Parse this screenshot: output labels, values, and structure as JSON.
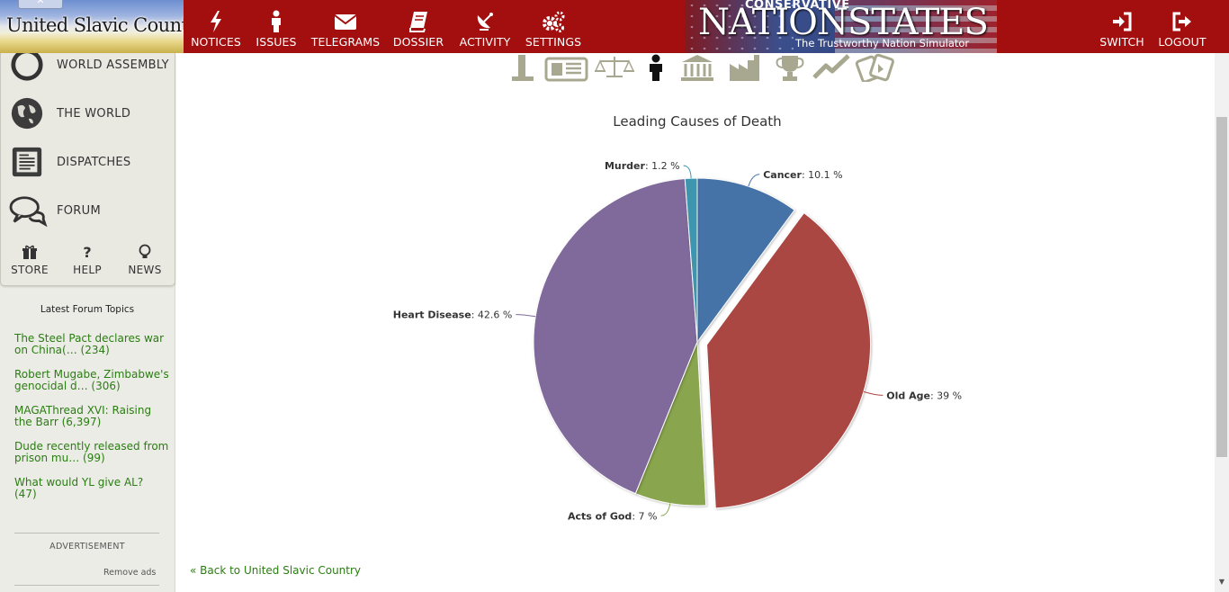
{
  "header": {
    "nation_name": "United Slavic Country",
    "nav": [
      {
        "label": "NOTICES",
        "icon": "lightning-icon"
      },
      {
        "label": "ISSUES",
        "icon": "person-icon"
      },
      {
        "label": "TELEGRAMS",
        "icon": "envelope-icon"
      },
      {
        "label": "DOSSIER",
        "icon": "book-icon"
      },
      {
        "label": "ACTIVITY",
        "icon": "satellite-dish-icon"
      },
      {
        "label": "SETTINGS",
        "icon": "gears-icon"
      }
    ],
    "logo": {
      "top_word": "CONSERVATIVE",
      "title": "NATIONSTATES",
      "tagline": "The Trustworthy Nation Simulator"
    },
    "right_nav": [
      {
        "label": "SWITCH",
        "icon": "sign-in-icon"
      },
      {
        "label": "LOGOUT",
        "icon": "sign-out-icon"
      }
    ],
    "colors": {
      "bar": "#a30f0f"
    }
  },
  "sidebar": {
    "menu": [
      {
        "label": "WORLD ASSEMBLY",
        "icon": "world-assembly-laurel-icon"
      },
      {
        "label": "THE WORLD",
        "icon": "globe-icon"
      },
      {
        "label": "DISPATCHES",
        "icon": "dispatch-document-icon"
      },
      {
        "label": "FORUM",
        "icon": "speech-bubbles-icon"
      }
    ],
    "tiles": [
      {
        "label": "STORE",
        "icon": "gift-icon"
      },
      {
        "label": "HELP",
        "icon": "question-icon"
      },
      {
        "label": "NEWS",
        "icon": "lightbulb-icon"
      }
    ],
    "forum_heading": "Latest Forum Topics",
    "forum_topics": [
      {
        "line1": "The Steel Pact declares war",
        "line2": "on China(… (234)"
      },
      {
        "line1": "Robert Mugabe, Zimbabwe's",
        "line2": "genocidal d… (306)"
      },
      {
        "line1": "MAGAThread XVI: Raising",
        "line2": "the Barr (6,397)"
      },
      {
        "line1": "Dude recently released from",
        "line2": "prison mu… (99)"
      },
      {
        "line1": "What would YL give AL?",
        "line2": "(47)"
      }
    ],
    "ad_label": "ADVERTISEMENT",
    "remove_ads": "Remove ads"
  },
  "main": {
    "category_icons": [
      "monument-icon",
      "newspaper-icon",
      "scales-icon",
      "person-icon",
      "government-building-icon",
      "factory-icon",
      "trophy-icon",
      "trend-line-icon",
      "cards-icon"
    ],
    "selected_category": "person-icon",
    "back_link": "« Back to United Slavic Country"
  },
  "chart_data": {
    "type": "pie",
    "title": "Leading Causes of Death",
    "slices": [
      {
        "name": "Cancer",
        "value": 10.1,
        "color": "#4572a7"
      },
      {
        "name": "Old Age",
        "value": 39,
        "color": "#aa4643",
        "exploded": true
      },
      {
        "name": "Acts of God",
        "value": 7,
        "color": "#89a54e"
      },
      {
        "name": "Heart Disease",
        "value": 42.6,
        "color": "#80699b"
      },
      {
        "name": "Murder",
        "value": 1.2,
        "color": "#3d96ae"
      }
    ],
    "label_suffix": " %"
  }
}
